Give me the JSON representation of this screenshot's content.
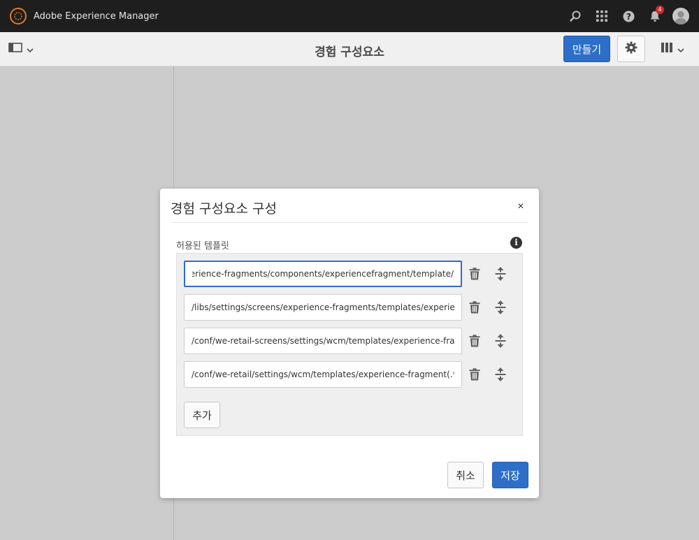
{
  "globalnav": {
    "product_name": "Adobe Experience Manager",
    "notification_count": "4"
  },
  "actionbar": {
    "page_title": "경험 구성요소",
    "create_label": "만들기"
  },
  "dialog": {
    "title": "경험 구성요소 구성",
    "close_label": "×",
    "field_label": "허용된 템플릿",
    "info_label": "i",
    "templates": [
      "/libs/cq/experience-fragments/components/experiencefragment/template",
      "/libs/settings/screens/experience-fragments/templates/experience-fragment-template",
      "/conf/we-retail-screens/settings/wcm/templates/experience-fragment-s",
      "/conf/we-retail/settings/wcm/templates/experience-fragment(.*)?"
    ],
    "add_label": "추가",
    "cancel_label": "취소",
    "save_label": "저장"
  },
  "colors": {
    "accent": "#2d6ec7",
    "topbar": "#1e1e1e",
    "backdrop": "#cccccc",
    "brand_ring": "#e07b2c",
    "notification": "#d12c2c"
  }
}
